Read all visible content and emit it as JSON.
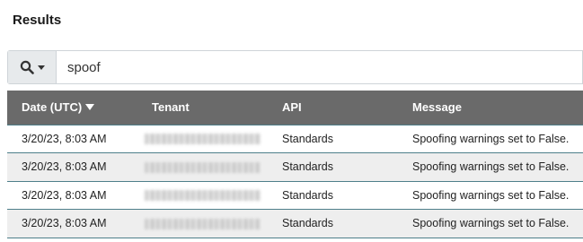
{
  "page": {
    "title": "Results"
  },
  "search": {
    "value": "spoof",
    "icon": "search-icon"
  },
  "table": {
    "headers": {
      "date": "Date (UTC)",
      "tenant": "Tenant",
      "api": "API",
      "message": "Message"
    },
    "sort": {
      "column": "date",
      "direction": "desc"
    },
    "rows": [
      {
        "date": "3/20/23, 8:03 AM",
        "tenant": "",
        "api": "Standards",
        "message": "Spoofing warnings set to False."
      },
      {
        "date": "3/20/23, 8:03 AM",
        "tenant": "",
        "api": "Standards",
        "message": "Spoofing warnings set to False."
      },
      {
        "date": "3/20/23, 8:03 AM",
        "tenant": "",
        "api": "Standards",
        "message": "Spoofing warnings set to False."
      },
      {
        "date": "3/20/23, 8:03 AM",
        "tenant": "",
        "api": "Standards",
        "message": "Spoofing warnings set to False."
      }
    ]
  },
  "colors": {
    "header_bg": "#6a6a6a",
    "row_alt_bg": "#eeeeee",
    "row_border": "#4e7f8a",
    "search_button_bg": "#e7eaec"
  }
}
